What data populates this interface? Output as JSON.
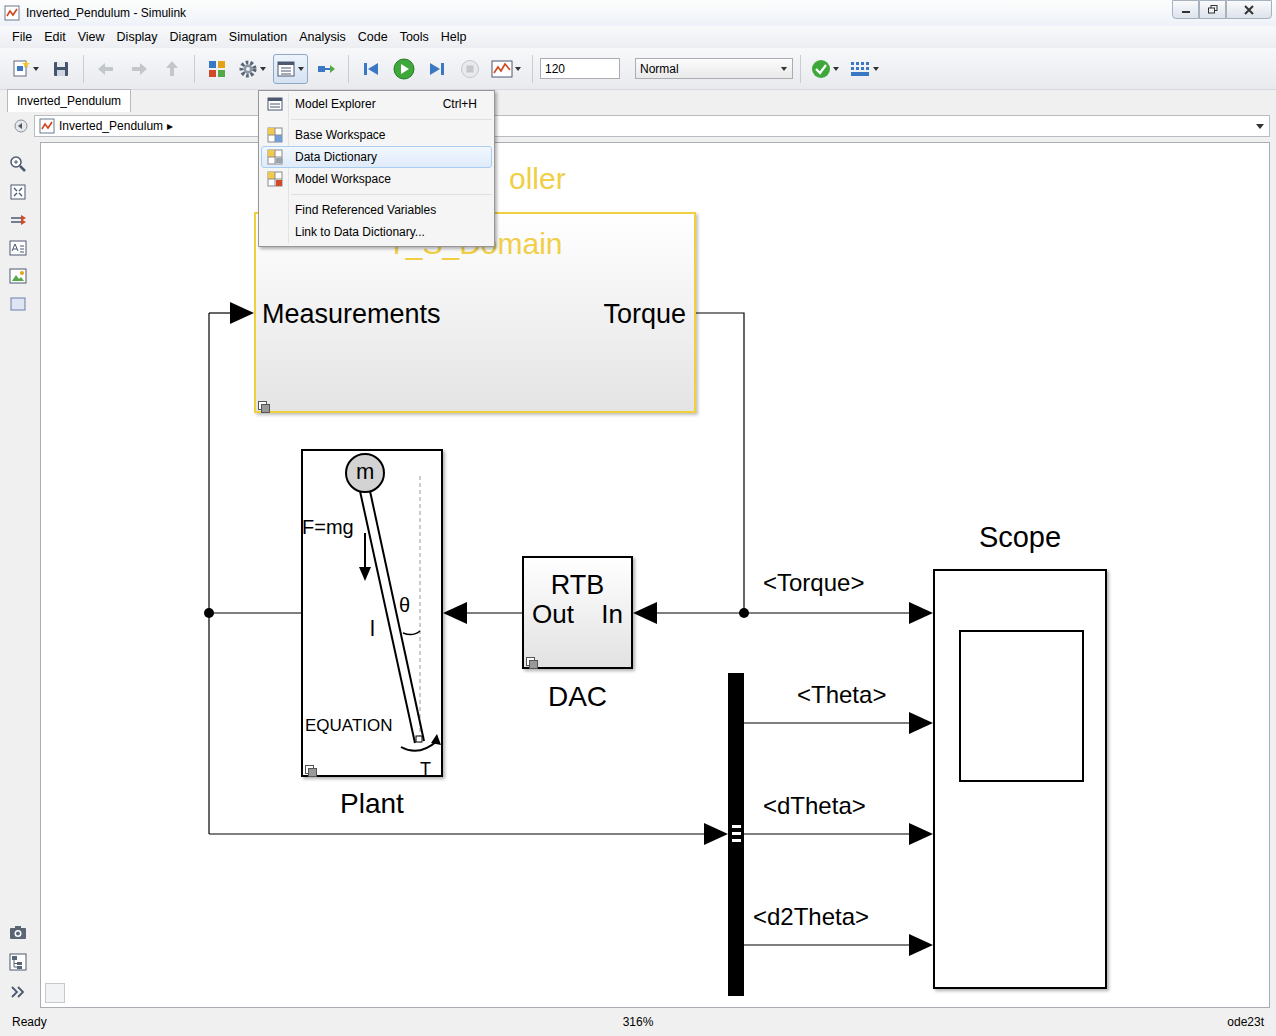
{
  "window": {
    "title": "Inverted_Pendulum - Simulink"
  },
  "menu_bar": {
    "items": [
      "File",
      "Edit",
      "View",
      "Display",
      "Diagram",
      "Simulation",
      "Analysis",
      "Code",
      "Tools",
      "Help"
    ]
  },
  "toolbar": {
    "lead_buttons": [
      {
        "disabled": false,
        "dropdown": true,
        "pressed": false
      },
      {
        "disabled": false,
        "dropdown": false,
        "pressed": false
      },
      {
        "disabled": true,
        "dropdown": false,
        "pressed": false
      },
      {
        "disabled": true,
        "dropdown": false,
        "pressed": false
      },
      {
        "disabled": true,
        "dropdown": false,
        "pressed": false
      },
      {
        "disabled": false,
        "dropdown": false,
        "pressed": false
      },
      {
        "disabled": false,
        "dropdown": true,
        "pressed": false
      },
      {
        "disabled": false,
        "dropdown": true,
        "pressed": true
      },
      {
        "disabled": false,
        "dropdown": false,
        "pressed": false
      },
      {
        "disabled": false,
        "dropdown": false,
        "pressed": false
      },
      {
        "disabled": false,
        "dropdown": false,
        "pressed": false
      },
      {
        "disabled": false,
        "dropdown": false,
        "pressed": false
      },
      {
        "disabled": true,
        "dropdown": false,
        "pressed": false
      },
      {
        "disabled": false,
        "dropdown": true,
        "pressed": false
      }
    ],
    "stop_time": "120",
    "mode": "Normal",
    "trail_buttons": [
      {
        "disabled": false,
        "dropdown": true,
        "pressed": false
      },
      {
        "disabled": false,
        "dropdown": true,
        "pressed": false
      }
    ]
  },
  "tabs": [
    {
      "label": "Inverted_Pendulum",
      "selected": true
    }
  ],
  "breadcrumb": {
    "items": [
      "Inverted_Pendulum"
    ],
    "separator": "▸"
  },
  "dropdown_menu": {
    "groups": [
      [
        {
          "label": "Model Explorer",
          "shortcut": "Ctrl+H",
          "selected": false
        }
      ],
      [
        {
          "label": "Base Workspace",
          "selected": false
        },
        {
          "label": "Data Dictionary",
          "selected": true
        },
        {
          "label": "Model Workspace",
          "selected": false
        }
      ],
      [
        {
          "label": "Find Referenced Variables",
          "selected": false
        },
        {
          "label": "Link to Data Dictionary...",
          "selected": false
        }
      ]
    ]
  },
  "diagram": {
    "controller": {
      "caption": "oller",
      "name": "T_S_Domain",
      "input": "Measurements",
      "output": "Torque"
    },
    "plant": {
      "label": "Plant",
      "mass": "m",
      "force": "F=mg",
      "length": "l",
      "angle": "θ",
      "equation": "EQUATION",
      "torque": "T"
    },
    "dac": {
      "label": "DAC",
      "title": "RTB",
      "out_port": "Out",
      "in_port": "In"
    },
    "scope": {
      "label": "Scope"
    },
    "signals": [
      {
        "label": "<Torque>"
      },
      {
        "label": "<Theta>"
      },
      {
        "label": "<dTheta>"
      },
      {
        "label": "<d2Theta>"
      }
    ]
  },
  "status_bar": {
    "message": "Ready",
    "zoom": "316%",
    "solver": "ode23t"
  }
}
